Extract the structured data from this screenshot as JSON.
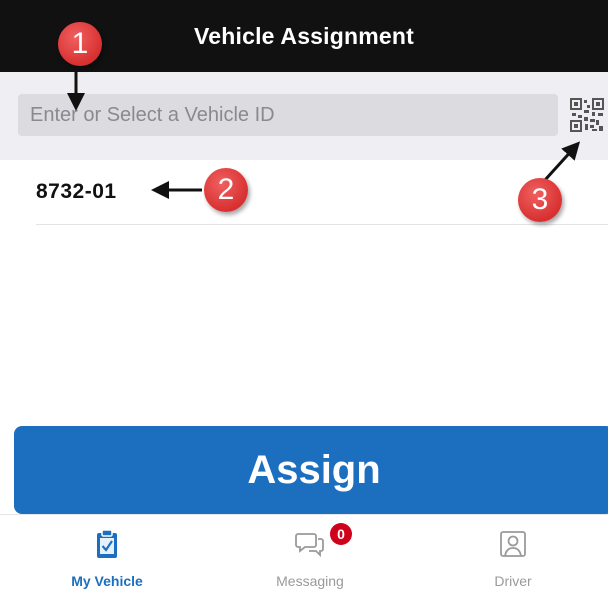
{
  "header": {
    "title": "Vehicle Assignment"
  },
  "search": {
    "placeholder": "Enter or Select a Vehicle ID",
    "scan_icon": "qr-code-icon"
  },
  "vehicle_list": {
    "items": [
      {
        "id": "8732-01"
      }
    ]
  },
  "assign_button": {
    "label": "Assign",
    "color": "#1c6fbf"
  },
  "tabbar": {
    "tabs": [
      {
        "label": "My Vehicle",
        "icon": "clipboard-check-icon",
        "active": true
      },
      {
        "label": "Messaging",
        "icon": "chat-bubbles-icon",
        "badge": "0"
      },
      {
        "label": "Driver",
        "icon": "person-icon"
      }
    ]
  },
  "annotations": {
    "callouts": [
      {
        "number": "1"
      },
      {
        "number": "2"
      },
      {
        "number": "3"
      }
    ],
    "color": "#d83030"
  }
}
